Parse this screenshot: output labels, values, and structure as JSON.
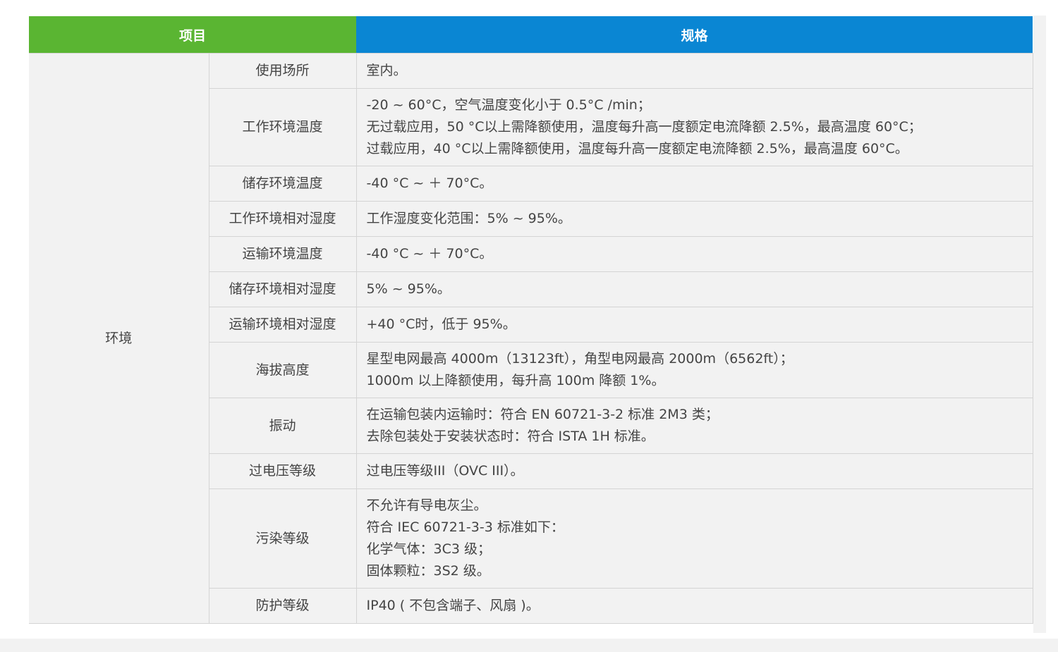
{
  "header": {
    "item": "项目",
    "spec": "规格"
  },
  "category": "环境",
  "rows": [
    {
      "item": "使用场所",
      "lines": [
        "室内。"
      ]
    },
    {
      "item": "工作环境温度",
      "lines": [
        "-20 ~ 60°C，空气温度变化小于 0.5°C /min；",
        "无过载应用，50 °C以上需降额使用，温度每升高一度额定电流降额 2.5%，最高温度 60°C；",
        "过载应用，40 °C以上需降额使用，温度每升高一度额定电流降额 2.5%，最高温度 60°C。"
      ]
    },
    {
      "item": "储存环境温度",
      "lines": [
        "-40 °C ~ ＋ 70°C。"
      ]
    },
    {
      "item": "工作环境相对湿度",
      "lines": [
        "工作湿度变化范围：5% ~ 95%。"
      ]
    },
    {
      "item": "运输环境温度",
      "lines": [
        "-40 °C ~ ＋ 70°C。"
      ]
    },
    {
      "item": "储存环境相对湿度",
      "lines": [
        "5% ~ 95%。"
      ]
    },
    {
      "item": "运输环境相对湿度",
      "lines": [
        "+40 °C时，低于 95%。"
      ]
    },
    {
      "item": "海拔高度",
      "lines": [
        "星型电网最高 4000m（13123ft），角型电网最高 2000m（6562ft）；",
        "1000m 以上降额使用，每升高 100m 降额 1%。"
      ]
    },
    {
      "item": "振动",
      "lines": [
        "在运输包装内运输时：符合 EN 60721-3-2 标准 2M3 类；",
        "去除包装处于安装状态时：符合 ISTA 1H 标准。"
      ]
    },
    {
      "item": "过电压等级",
      "lines": [
        "过电压等级III（OVC III）。"
      ]
    },
    {
      "item": "污染等级",
      "lines": [
        "不允许有导电灰尘。",
        "符合 IEC 60721-3-3 标准如下：",
        "化学气体：3C3 级；",
        "固体颗粒：3S2 级。"
      ]
    },
    {
      "item": "防护等级",
      "lines": [
        "IP40 ( 不包含端子、风扇 )。"
      ]
    }
  ],
  "colors": {
    "header_item_bg": "#5ab532",
    "header_spec_bg": "#0a86d3",
    "cell_bg": "#f2f2f2",
    "border": "#d4d4d4",
    "text": "#444444"
  }
}
